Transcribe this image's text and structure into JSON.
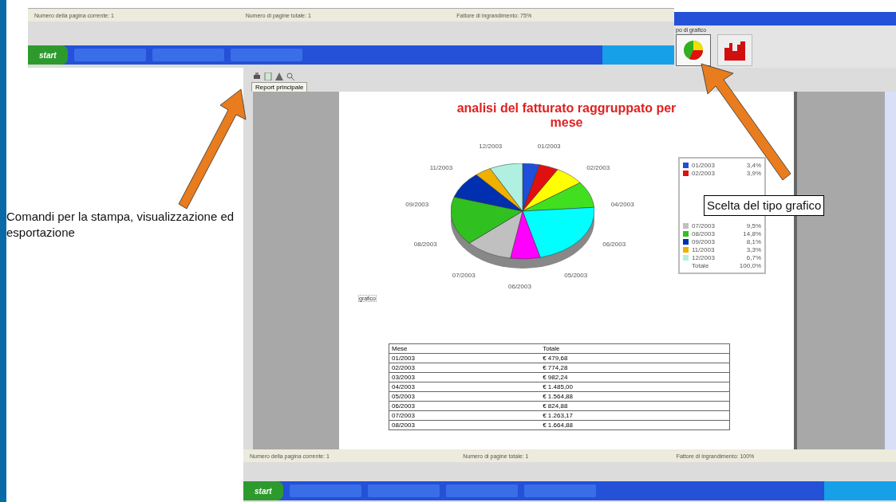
{
  "top_window": {
    "status_bar": [
      "Numero della pagina corrente: 1",
      "Numero di pagine totale: 1",
      "Fattore di ingrandimento: 75%"
    ],
    "taskbar": {
      "start": "start"
    }
  },
  "side_window": {
    "group_label": "po di grafico",
    "chart_types": [
      {
        "kind": "pie",
        "selected": true
      },
      {
        "kind": "bar",
        "selected": false
      }
    ]
  },
  "main_window": {
    "tabs": [
      {
        "label": "Report principale",
        "selected": true
      }
    ],
    "report": {
      "title": "analisi del fatturato raggruppato per mese",
      "pie_labels": [
        "12/2003",
        "01/2003",
        "11/2003",
        "02/2003",
        "09/2003",
        "04/2003",
        "08/2003",
        "06/2003",
        "07/2003",
        "05/2003",
        "06/2003"
      ],
      "legend": [
        {
          "label": "01/2003",
          "value": "3,4%",
          "color": "#1f4fd8"
        },
        {
          "label": "02/2003",
          "value": "3,9%",
          "color": "#e01010"
        },
        {
          "label": "07/2003",
          "value": "9,5%",
          "color": "#c0c0c0"
        },
        {
          "label": "08/2003",
          "value": "14,8%",
          "color": "#30c020"
        },
        {
          "label": "09/2003",
          "value": "8,1%",
          "color": "#0030b0"
        },
        {
          "label": "11/2003",
          "value": "3,3%",
          "color": "#f0b000"
        },
        {
          "label": "12/2003",
          "value": "6,7%",
          "color": "#b0f0e0"
        }
      ],
      "legend_total": {
        "label": "Totale",
        "value": "100,0%"
      },
      "caption": "grafico",
      "table": {
        "columns": [
          "Mese",
          "Totale"
        ],
        "rows": [
          [
            "01/2003",
            "€ 479,68"
          ],
          [
            "02/2003",
            "€ 774,28"
          ],
          [
            "03/2003",
            "€ 982,24"
          ],
          [
            "04/2003",
            "€ 1.485,00"
          ],
          [
            "05/2003",
            "€ 1.564,88"
          ],
          [
            "06/2003",
            "€ 824,88"
          ],
          [
            "07/2003",
            "€ 1.263,17"
          ],
          [
            "08/2003",
            "€ 1.664,88"
          ]
        ]
      }
    },
    "status_bar": [
      "Numero della pagina corrente: 1",
      "Numero di pagine totale: 1",
      "Fattore di ingrandimento: 100%"
    ],
    "taskbar": {
      "start": "start"
    }
  },
  "annotations": [
    {
      "text": "Comandi per la stampa, visualizzazione ed esportazione",
      "kind": "plain"
    },
    {
      "text": "Scelta del tipo grafico",
      "kind": "boxed"
    }
  ]
}
